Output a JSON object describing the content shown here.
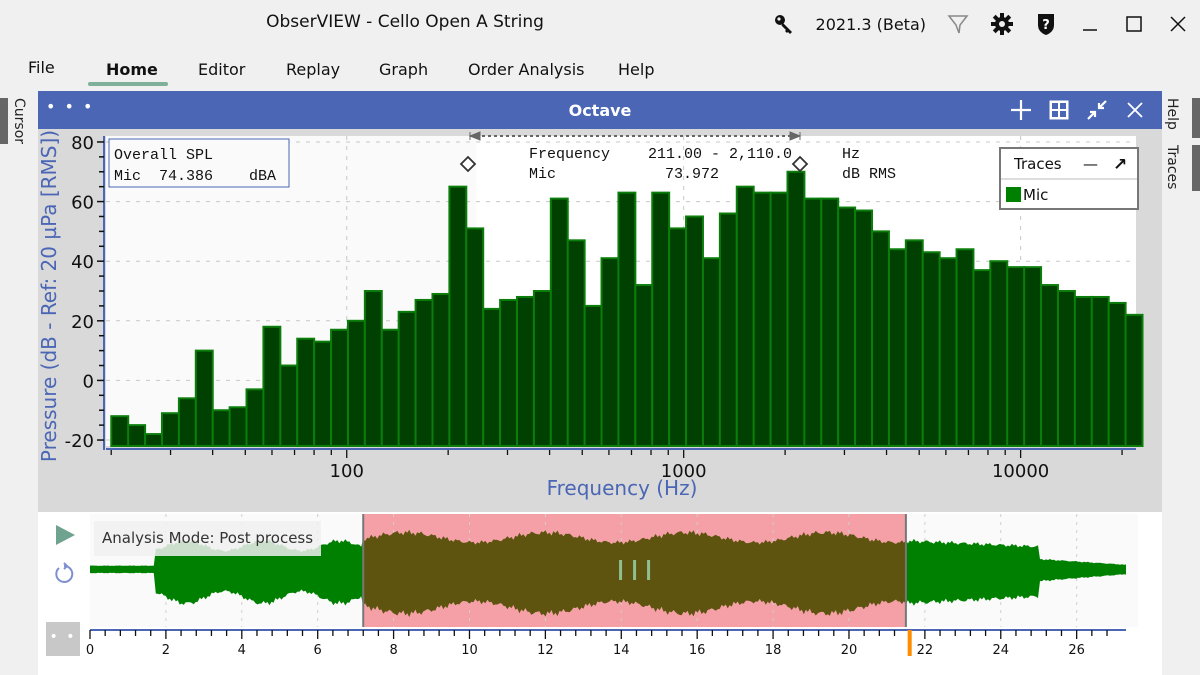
{
  "window": {
    "title": "ObserVIEW - Cello Open A String",
    "version": "2021.3 (Beta)",
    "icons": [
      "key-icon",
      "filter-icon",
      "gear-icon",
      "help-shield-icon",
      "minimize-icon",
      "maximize-icon",
      "close-icon"
    ]
  },
  "menu": {
    "items": [
      {
        "label": "File",
        "active": false
      },
      {
        "label": "Home",
        "active": true
      },
      {
        "label": "Editor",
        "active": false
      },
      {
        "label": "Replay",
        "active": false
      },
      {
        "label": "Graph",
        "active": false
      },
      {
        "label": "Order Analysis",
        "active": false
      },
      {
        "label": "Help",
        "active": false
      }
    ]
  },
  "side_tabs": {
    "left": [
      "Cursor"
    ],
    "right": [
      "Help",
      "Traces"
    ]
  },
  "panel": {
    "title": "Octave",
    "menu_dots": "• • •",
    "header_icons": [
      "add-icon",
      "grid-layout-icon",
      "collapse-icon",
      "close-icon"
    ]
  },
  "overall_spl": {
    "title": "Overall SPL",
    "channel": "Mic",
    "value": "74.386",
    "unit": "dBA"
  },
  "cursor_readout": {
    "label_row1": "Frequency",
    "value_row1": "211.00 - 2,110.0",
    "unit_row1": "Hz",
    "label_row2": "Mic",
    "value_row2": "73.972",
    "unit_row2": "dB RMS",
    "range_hz": [
      211.0,
      2110.0
    ]
  },
  "legend": {
    "title": "Traces",
    "minimize": "—",
    "popout": "↗",
    "items": [
      {
        "name": "Mic",
        "color": "#008000"
      }
    ]
  },
  "chart_data": {
    "type": "bar",
    "title": "Octave",
    "xlabel": "Frequency (Hz)",
    "ylabel": "Pressure (dB - Ref: 20 µPa [RMS])",
    "xscale": "log",
    "xlim": [
      19.3,
      22000
    ],
    "ylim": [
      -22,
      82
    ],
    "yticks": [
      -20,
      0,
      20,
      40,
      60,
      80
    ],
    "xticks": [
      100,
      1000,
      10000
    ],
    "xtick_labels": [
      "100",
      "1000",
      "10000"
    ],
    "grid": true,
    "legend_position": "top-right",
    "band_resolution": "1/6 octave",
    "series": [
      {
        "name": "Mic",
        "fill": "#004000",
        "stroke": "#0a7d0a",
        "first_band_center_hz": 21.2,
        "bands_per_octave": 6,
        "values": [
          -12,
          -15,
          -18,
          -11,
          -6,
          10,
          -10,
          -9,
          -3,
          18,
          5,
          14,
          13,
          17,
          20,
          30,
          17,
          23,
          27,
          29,
          65,
          51,
          24,
          27,
          28,
          30,
          61,
          47,
          25,
          41,
          63,
          32,
          63,
          51,
          55,
          41,
          56,
          65,
          63,
          63,
          70,
          61,
          61,
          58,
          57,
          50,
          44,
          47,
          43,
          41,
          44,
          37,
          40,
          38,
          38,
          32,
          30,
          28,
          28,
          26,
          22
        ]
      }
    ]
  },
  "timeline": {
    "mode_label": "Analysis Mode: Post process",
    "more_dots": "• • •",
    "xticks": [
      0,
      2,
      4,
      6,
      8,
      10,
      12,
      14,
      16,
      18,
      20,
      22,
      24,
      26
    ],
    "duration_s": 27.3,
    "selection_s": [
      7.2,
      21.5
    ],
    "playhead_s": 21.6,
    "colors": {
      "wave": "#008000",
      "wave_selected": "#5e5410",
      "selection": "#f4a0a6",
      "playhead": "#ff8c00",
      "axis": "#4a66b5"
    }
  }
}
